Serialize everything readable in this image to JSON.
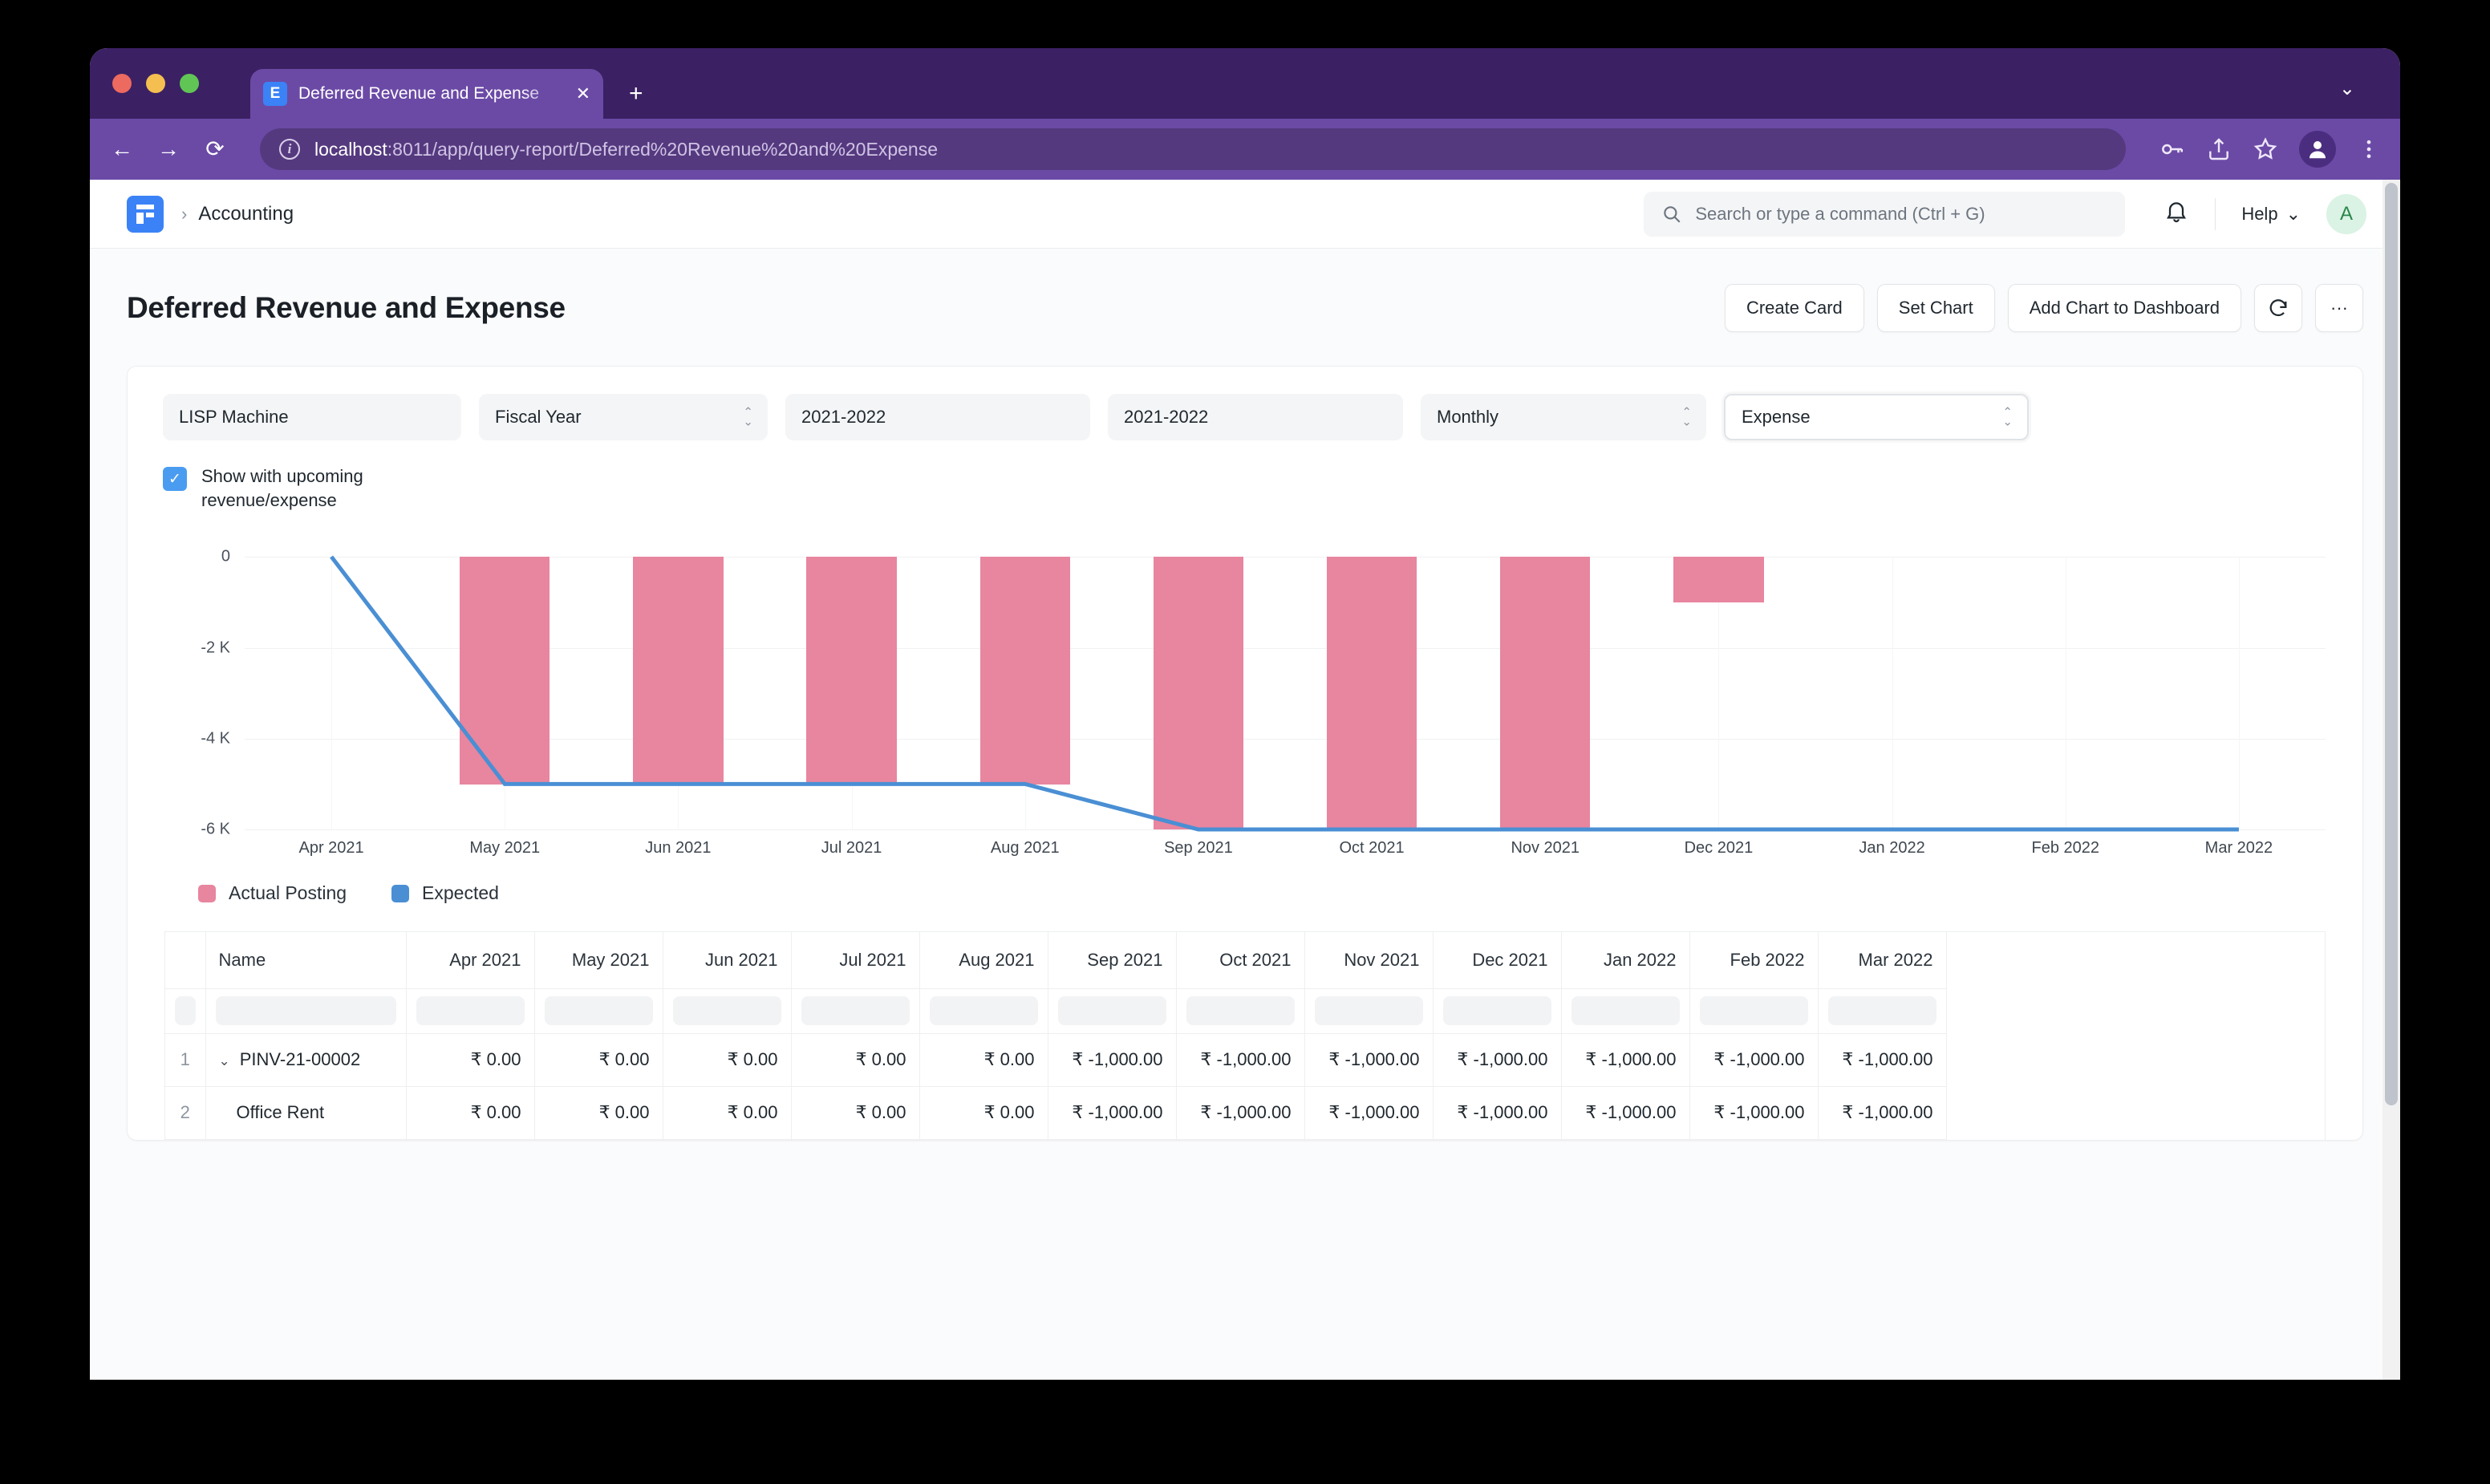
{
  "browser": {
    "tab_title": "Deferred Revenue and Expense",
    "tab_close": "✕",
    "new_tab": "+",
    "window_chevron": "⌄",
    "back": "←",
    "forward": "→",
    "reload": "⟳",
    "url_host": "localhost",
    "url_path": ":8011/app/query-report/Deferred%20Revenue%20and%20Expense"
  },
  "navbar": {
    "breadcrumb_separator": "›",
    "breadcrumb": "Accounting",
    "search_placeholder": "Search or type a command (Ctrl + G)",
    "help_label": "Help",
    "help_caret": "⌄",
    "avatar_initial": "A"
  },
  "page": {
    "title": "Deferred Revenue and Expense",
    "buttons": [
      {
        "label": "Create Card"
      },
      {
        "label": "Set Chart"
      },
      {
        "label": "Add Chart to Dashboard"
      }
    ],
    "refresh_icon": "refresh-icon",
    "menu_label": "···"
  },
  "filters": [
    {
      "name": "company",
      "value": "LISP Machine",
      "type": "text"
    },
    {
      "name": "filter-based-on",
      "value": "Fiscal Year",
      "type": "select"
    },
    {
      "name": "from-fiscal-year",
      "value": "2021-2022",
      "type": "text"
    },
    {
      "name": "to-fiscal-year",
      "value": "2021-2022",
      "type": "text"
    },
    {
      "name": "periodicity",
      "value": "Monthly",
      "type": "select"
    },
    {
      "name": "type",
      "value": "Expense",
      "type": "select",
      "active": true
    }
  ],
  "checkbox": {
    "checked": true,
    "check_glyph": "✓",
    "label": "Show with upcoming revenue/expense"
  },
  "chart_data": {
    "type": "bar",
    "title": "",
    "xlabel": "",
    "ylabel": "",
    "categories": [
      "Apr 2021",
      "May 2021",
      "Jun 2021",
      "Jul 2021",
      "Aug 2021",
      "Sep 2021",
      "Oct 2021",
      "Nov 2021",
      "Dec 2021",
      "Jan 2022",
      "Feb 2022",
      "Mar 2022"
    ],
    "ylim": [
      -6000,
      0
    ],
    "yticks": [
      0,
      -2000,
      -4000,
      -6000
    ],
    "ytick_labels": [
      "0",
      "-2 K",
      "-4 K",
      "-6 K"
    ],
    "grid": true,
    "legend_position": "bottom-left",
    "series": [
      {
        "name": "Actual Posting",
        "type": "bar",
        "color": "#e8859f",
        "values": [
          0,
          -5000,
          -5000,
          -5000,
          -5000,
          -6000,
          -6000,
          -6000,
          -1000,
          0,
          0,
          0
        ]
      },
      {
        "name": "Expected",
        "type": "line",
        "color": "#4a8fd4",
        "values": [
          0,
          -5000,
          -5000,
          -5000,
          -5000,
          -6000,
          -6000,
          -6000,
          -6000,
          -6000,
          -6000,
          -6000
        ]
      }
    ]
  },
  "table": {
    "columns": [
      "",
      "Name",
      "Apr 2021",
      "May 2021",
      "Jun 2021",
      "Jul 2021",
      "Aug 2021",
      "Sep 2021",
      "Oct 2021",
      "Nov 2021",
      "Dec 2021",
      "Jan 2022",
      "Feb 2022",
      "Mar 2022"
    ],
    "filter_row_placeholder": "",
    "rows": [
      {
        "index": "1",
        "name": "PINV-21-00002",
        "expandable": true,
        "chevron": "⌄",
        "indent": false,
        "values": [
          "₹ 0.00",
          "₹ 0.00",
          "₹ 0.00",
          "₹ 0.00",
          "₹ 0.00",
          "₹ -1,000.00",
          "₹ -1,000.00",
          "₹ -1,000.00",
          "₹ -1,000.00",
          "₹ -1,000.00",
          "₹ -1,000.00",
          "₹ -1,000.00"
        ]
      },
      {
        "index": "2",
        "name": "Office Rent",
        "expandable": false,
        "chevron": "",
        "indent": true,
        "values": [
          "₹ 0.00",
          "₹ 0.00",
          "₹ 0.00",
          "₹ 0.00",
          "₹ 0.00",
          "₹ -1,000.00",
          "₹ -1,000.00",
          "₹ -1,000.00",
          "₹ -1,000.00",
          "₹ -1,000.00",
          "₹ -1,000.00",
          "₹ -1,000.00"
        ]
      }
    ]
  },
  "colors": {
    "accent": "#3b82f6",
    "bar": "#e8859f",
    "line": "#4a8fd4",
    "browser_chrome": "#6b4aa6",
    "browser_titlebar": "#3b2063"
  }
}
